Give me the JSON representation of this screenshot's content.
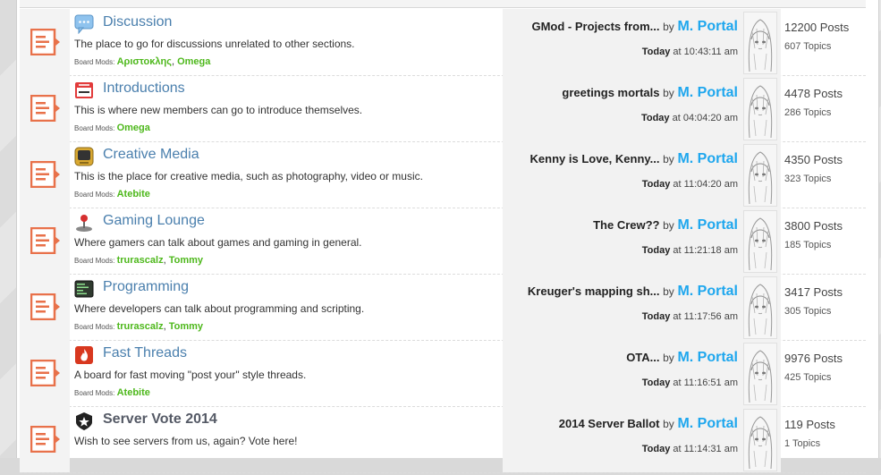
{
  "boards": [
    {
      "title": "Discussion",
      "icon": "speech-bubble-icon",
      "description": "The place to go for discussions unrelated to other sections.",
      "mods_label": "Board Mods:",
      "mods": [
        "Αριστοκλης",
        "Omega"
      ],
      "last_topic": "GMod - Projects from...",
      "by": "by",
      "last_user": "M. Portal",
      "date_prefix": "Today",
      "time": "at 10:43:11 am",
      "posts": "12200 Posts",
      "topics": "607 Topics"
    },
    {
      "title": "Introductions",
      "icon": "name-tag-icon",
      "description": "This is where new members can go to introduce themselves.",
      "mods_label": "Board Mods:",
      "mods": [
        "Omega"
      ],
      "last_topic": "greetings mortals",
      "by": "by",
      "last_user": "M. Portal",
      "date_prefix": "Today",
      "time": "at 04:04:20 am",
      "posts": "4478 Posts",
      "topics": "286 Topics"
    },
    {
      "title": "Creative Media",
      "icon": "tv-icon",
      "description": "This is the place for creative media, such as photography, video or music.",
      "mods_label": "Board Mods:",
      "mods": [
        "Atebite"
      ],
      "last_topic": "Kenny is Love, Kenny...",
      "by": "by",
      "last_user": "M. Portal",
      "date_prefix": "Today",
      "time": "at 11:04:20 am",
      "posts": "4350 Posts",
      "topics": "323 Topics"
    },
    {
      "title": "Gaming Lounge",
      "icon": "joystick-icon",
      "description": "Where gamers can talk about games and gaming in general.",
      "mods_label": "Board Mods:",
      "mods": [
        "trurascalz",
        "Tommy"
      ],
      "last_topic": "The Crew??",
      "by": "by",
      "last_user": "M. Portal",
      "date_prefix": "Today",
      "time": "at 11:21:18 am",
      "posts": "3800 Posts",
      "topics": "185 Topics"
    },
    {
      "title": "Programming",
      "icon": "terminal-icon",
      "description": "Where developers can talk about programming and scripting.",
      "mods_label": "Board Mods:",
      "mods": [
        "trurascalz",
        "Tommy"
      ],
      "last_topic": "Kreuger's mapping sh...",
      "by": "by",
      "last_user": "M. Portal",
      "date_prefix": "Today",
      "time": "at 11:17:56 am",
      "posts": "3417 Posts",
      "topics": "305 Topics"
    },
    {
      "title": "Fast Threads",
      "icon": "flame-icon",
      "description": "A board for fast moving \"post your\" style threads.",
      "mods_label": "Board Mods:",
      "mods": [
        "Atebite"
      ],
      "last_topic": "OTA...",
      "by": "by",
      "last_user": "M. Portal",
      "date_prefix": "Today",
      "time": "at 11:16:51 am",
      "posts": "9976 Posts",
      "topics": "425 Topics"
    },
    {
      "title": "Server Vote 2014",
      "icon": "star-badge-icon",
      "description": "Wish to see servers from us, again? Vote here!",
      "mods_label": "",
      "mods": [],
      "last_topic": "2014 Server Ballot",
      "by": "by",
      "last_user": "M. Portal",
      "date_prefix": "Today",
      "time": "at 11:14:31 am",
      "posts": "119 Posts",
      "topics": "1 Topics"
    }
  ],
  "colors": {
    "title_link": "#4a7fad",
    "mod_link": "#4eb81c",
    "user_link": "#1fa7ee",
    "status_icon": "#e8714a"
  }
}
